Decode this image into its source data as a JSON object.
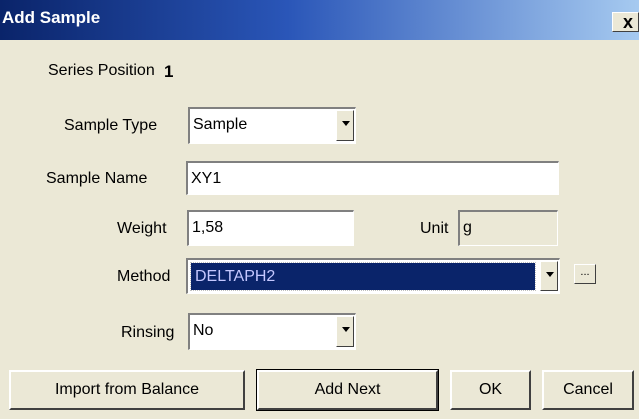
{
  "window": {
    "title": "Add Sample",
    "close_glyph": "x"
  },
  "series_position": {
    "label": "Series Position",
    "value": "1"
  },
  "sample_type": {
    "label": "Sample Type",
    "value": "Sample"
  },
  "sample_name": {
    "label": "Sample Name",
    "value": "XY1"
  },
  "weight": {
    "label": "Weight",
    "value": "1,58"
  },
  "unit": {
    "label": "Unit",
    "value": "g"
  },
  "method": {
    "label": "Method",
    "value": "DELTAPH2",
    "browse_label": "..."
  },
  "rinsing": {
    "label": "Rinsing",
    "value": "No"
  },
  "buttons": {
    "import_from_balance": "Import from Balance",
    "add_next": "Add Next",
    "ok": "OK",
    "cancel": "Cancel"
  },
  "colors": {
    "title_gradient_start": "#0a246a",
    "title_gradient_end": "#a6caf0",
    "dialog_bg": "#ebe8d6",
    "selection_bg": "#0a246a"
  }
}
